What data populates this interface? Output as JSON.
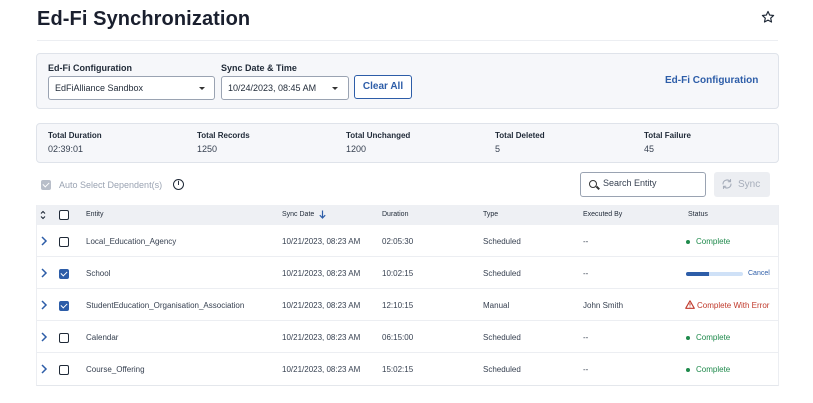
{
  "page": {
    "title": "Ed-Fi Synchronization"
  },
  "filters": {
    "config_label": "Ed-Fi Configuration",
    "config_value": "EdFiAlliance Sandbox",
    "sync_label": "Sync Date & Time",
    "sync_value": "10/24/2023, 08:45 AM",
    "clear_all": "Clear All",
    "config_link": "Ed-Fi Configuration"
  },
  "stats": [
    {
      "label": "Total Duration",
      "value": "02:39:01"
    },
    {
      "label": "Total Records",
      "value": "1250"
    },
    {
      "label": "Total Unchanged",
      "value": "1200"
    },
    {
      "label": "Total Deleted",
      "value": "5"
    },
    {
      "label": "Total Failure",
      "value": "45"
    }
  ],
  "toolbar": {
    "auto_select_label": "Auto Select Dependent(s)",
    "search_placeholder": "Search Entity",
    "sync_label": "Sync"
  },
  "table": {
    "headers": {
      "entity": "Entity",
      "sync_date": "Sync Date",
      "duration": "Duration",
      "type": "Type",
      "executed_by": "Executed By",
      "status": "Status"
    },
    "rows": [
      {
        "entity": "Local_Education_Agency",
        "sync_date": "10/21/2023, 08:23 AM",
        "duration": "02:05:30",
        "type": "Scheduled",
        "executed_by": "--",
        "status": "Complete",
        "checked": false
      },
      {
        "entity": "School",
        "sync_date": "10/21/2023, 08:23 AM",
        "duration": "10:02:15",
        "type": "Scheduled",
        "executed_by": "--",
        "status": "Cancel",
        "progress": 0.4,
        "checked": true
      },
      {
        "entity": "StudentEducation_Organisation_Association",
        "sync_date": "10/21/2023, 08:23 AM",
        "duration": "12:10:15",
        "type": "Manual",
        "executed_by": "John Smith",
        "status": "Complete With Error",
        "checked": true
      },
      {
        "entity": "Calendar",
        "sync_date": "10/21/2023, 08:23 AM",
        "duration": "06:15:00",
        "type": "Scheduled",
        "executed_by": "--",
        "status": "Complete",
        "checked": false
      },
      {
        "entity": "Course_Offering",
        "sync_date": "10/21/2023, 08:23 AM",
        "duration": "15:02:15",
        "type": "Scheduled",
        "executed_by": "--",
        "status": "Complete",
        "checked": false
      }
    ]
  },
  "colors": {
    "accent": "#2d5da8",
    "success": "#1f8a4c",
    "error": "#c0392b",
    "panel": "#f6f7fa"
  },
  "icons": [
    "star-icon",
    "chevron-down-icon",
    "info-icon",
    "search-icon",
    "sync-icon",
    "sort-icon",
    "sort-down-arrow-icon",
    "chevron-right-icon",
    "warning-icon"
  ]
}
